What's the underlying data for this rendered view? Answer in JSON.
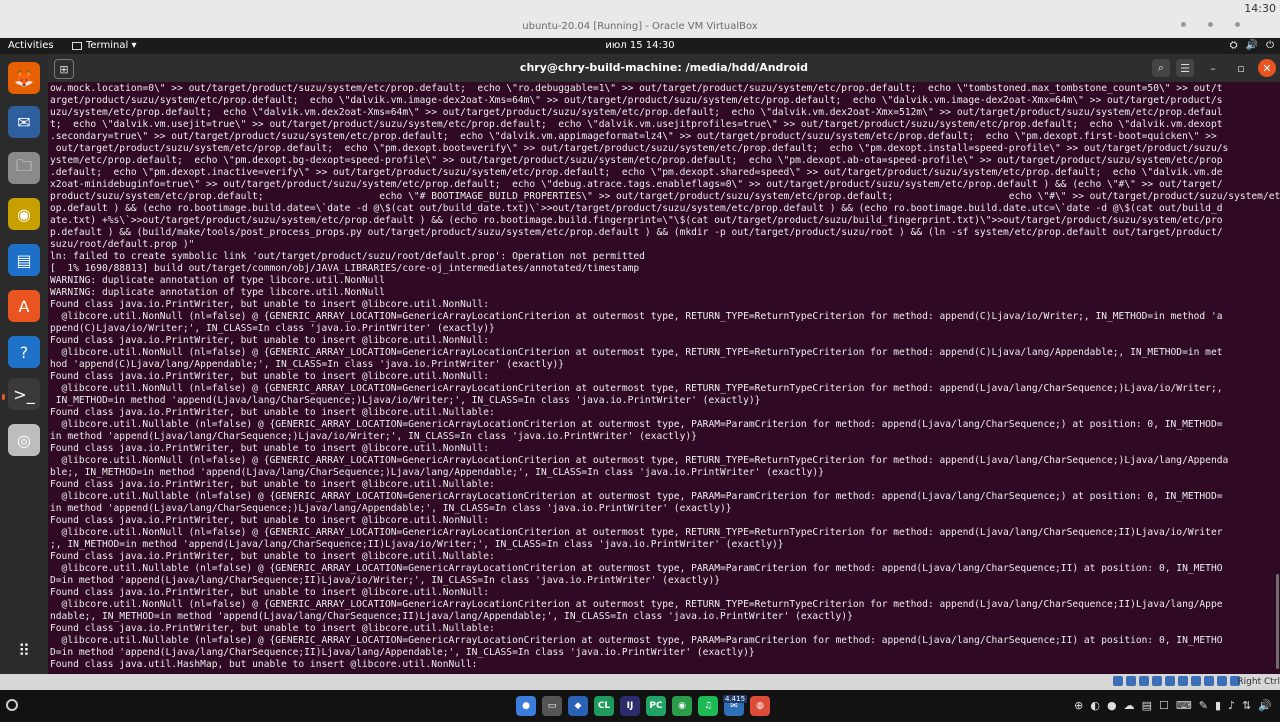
{
  "host": {
    "window_title": "ubuntu-20.04 [Running] - Oracle VM VirtualBox",
    "clock": "14:30",
    "host_key": "Right Ctrl"
  },
  "topbar": {
    "activities": "Activities",
    "app_name": "Terminal ▾",
    "datetime": "июл 15  14:30",
    "tray": [
      "⛭",
      "🔊",
      "⏻"
    ]
  },
  "dock": {
    "items": [
      {
        "name": "firefox-icon",
        "glyph": "🦊",
        "color": "#e66000"
      },
      {
        "name": "thunderbird-icon",
        "glyph": "✉",
        "color": "#2f5e9e"
      },
      {
        "name": "files-icon",
        "glyph": "🗀",
        "color": "#8a8a8a"
      },
      {
        "name": "rhythmbox-icon",
        "glyph": "◉",
        "color": "#c7a000"
      },
      {
        "name": "writer-icon",
        "glyph": "▤",
        "color": "#1e6fc8"
      },
      {
        "name": "software-icon",
        "glyph": "A",
        "color": "#e95420"
      },
      {
        "name": "help-icon",
        "glyph": "?",
        "color": "#1e73c8"
      },
      {
        "name": "terminal-icon",
        "glyph": ">_",
        "color": "#3a3a3a"
      },
      {
        "name": "dvd-icon",
        "glyph": "◎",
        "color": "#bdbdbd"
      },
      {
        "name": "show-apps-icon",
        "glyph": "⠿",
        "color": "transparent"
      }
    ]
  },
  "terminal": {
    "title": "chry@chry-build-machine: /media/hdd/Android",
    "lines": [
      "ow.mock.location=0\\\" >> out/target/product/suzu/system/etc/prop.default;  echo \\\"ro.debuggable=1\\\" >> out/target/product/suzu/system/etc/prop.default;  echo \\\"tombstoned.max_tombstone_count=50\\\" >> out/t",
      "arget/product/suzu/system/etc/prop.default;  echo \\\"dalvik.vm.image-dex2oat-Xms=64m\\\" >> out/target/product/suzu/system/etc/prop.default;  echo \\\"dalvik.vm.image-dex2oat-Xmx=64m\\\" >> out/target/product/s",
      "uzu/system/etc/prop.default;  echo \\\"dalvik.vm.dex2oat-Xms=64m\\\" >> out/target/product/suzu/system/etc/prop.default;  echo \\\"dalvik.vm.dex2oat-Xmx=512m\\\" >> out/target/product/suzu/system/etc/prop.defaul",
      "t;  echo \\\"dalvik.vm.usejit=true\\\" >> out/target/product/suzu/system/etc/prop.default;  echo \\\"dalvik.vm.usejitprofiles=true\\\" >> out/target/product/suzu/system/etc/prop.default;  echo \\\"dalvik.vm.dexopt",
      ".secondary=true\\\" >> out/target/product/suzu/system/etc/prop.default;  echo \\\"dalvik.vm.appimageformat=lz4\\\" >> out/target/product/suzu/system/etc/prop.default;  echo \\\"pm.dexopt.first-boot=quicken\\\" >>",
      " out/target/product/suzu/system/etc/prop.default;  echo \\\"pm.dexopt.boot=verify\\\" >> out/target/product/suzu/system/etc/prop.default;  echo \\\"pm.dexopt.install=speed-profile\\\" >> out/target/product/suzu/s",
      "ystem/etc/prop.default;  echo \\\"pm.dexopt.bg-dexopt=speed-profile\\\" >> out/target/product/suzu/system/etc/prop.default;  echo \\\"pm.dexopt.ab-ota=speed-profile\\\" >> out/target/product/suzu/system/etc/prop",
      ".default;  echo \\\"pm.dexopt.inactive=verify\\\" >> out/target/product/suzu/system/etc/prop.default;  echo \\\"pm.dexopt.shared=speed\\\" >> out/target/product/suzu/system/etc/prop.default;  echo \\\"dalvik.vm.de",
      "x2oat-minidebuginfo=true\\\" >> out/target/product/suzu/system/etc/prop.default;  echo \\\"debug.atrace.tags.enableflags=0\\\" >> out/target/product/suzu/system/etc/prop.default ) && (echo \\\"#\\\" >> out/target/",
      "product/suzu/system/etc/prop.default;                    echo \\\"# BOOTIMAGE_BUILD_PROPERTIES\\\" >> out/target/product/suzu/system/etc/prop.default;                    echo \\\"#\\\" >> out/target/product/suzu/system/etc/pr",
      "op.default ) && (echo ro.bootimage.build.date=\\`date -d @\\$(cat out/build_date.txt)\\`>>out/target/product/suzu/system/etc/prop.default ) && (echo ro.bootimage.build.date.utc=\\`date -d @\\$(cat out/build_d",
      "ate.txt) +%s\\`>>out/target/product/suzu/system/etc/prop.default ) && (echo ro.bootimage.build.fingerprint=\\\"\\$(cat out/target/product/suzu/build_fingerprint.txt)\\\">>out/target/product/suzu/system/etc/pro",
      "p.default ) && (build/make/tools/post_process_props.py out/target/product/suzu/system/etc/prop.default ) && (mkdir -p out/target/product/suzu/root ) && (ln -sf system/etc/prop.default out/target/product/",
      "suzu/root/default.prop )\"",
      "ln: failed to create symbolic link 'out/target/product/suzu/root/default.prop': Operation not permitted",
      "[  1% 1690/88813] build out/target/common/obj/JAVA_LIBRARIES/core-oj_intermediates/annotated/timestamp",
      "WARNING: duplicate annotation of type libcore.util.NonNull",
      "WARNING: duplicate annotation of type libcore.util.NonNull",
      "Found class java.io.PrintWriter, but unable to insert @libcore.util.NonNull:",
      "  @libcore.util.NonNull (nl=false) @ {GENERIC_ARRAY_LOCATION=GenericArrayLocationCriterion at outermost type, RETURN_TYPE=ReturnTypeCriterion for method: append(C)Ljava/io/Writer;, IN_METHOD=in method 'a",
      "ppend(C)Ljava/io/Writer;', IN_CLASS=In class 'java.io.PrintWriter' (exactly)}",
      "Found class java.io.PrintWriter, but unable to insert @libcore.util.NonNull:",
      "  @libcore.util.NonNull (nl=false) @ {GENERIC_ARRAY_LOCATION=GenericArrayLocationCriterion at outermost type, RETURN_TYPE=ReturnTypeCriterion for method: append(C)Ljava/lang/Appendable;, IN_METHOD=in met",
      "hod 'append(C)Ljava/lang/Appendable;', IN_CLASS=In class 'java.io.PrintWriter' (exactly)}",
      "Found class java.io.PrintWriter, but unable to insert @libcore.util.NonNull:",
      "  @libcore.util.NonNull (nl=false) @ {GENERIC_ARRAY_LOCATION=GenericArrayLocationCriterion at outermost type, RETURN_TYPE=ReturnTypeCriterion for method: append(Ljava/lang/CharSequence;)Ljava/io/Writer;,",
      " IN_METHOD=in method 'append(Ljava/lang/CharSequence;)Ljava/io/Writer;', IN_CLASS=In class 'java.io.PrintWriter' (exactly)}",
      "Found class java.io.PrintWriter, but unable to insert @libcore.util.Nullable:",
      "  @libcore.util.Nullable (nl=false) @ {GENERIC_ARRAY_LOCATION=GenericArrayLocationCriterion at outermost type, PARAM=ParamCriterion for method: append(Ljava/lang/CharSequence;) at position: 0, IN_METHOD=",
      "in method 'append(Ljava/lang/CharSequence;)Ljava/io/Writer;', IN_CLASS=In class 'java.io.PrintWriter' (exactly)}",
      "Found class java.io.PrintWriter, but unable to insert @libcore.util.NonNull:",
      "  @libcore.util.NonNull (nl=false) @ {GENERIC_ARRAY_LOCATION=GenericArrayLocationCriterion at outermost type, RETURN_TYPE=ReturnTypeCriterion for method: append(Ljava/lang/CharSequence;)Ljava/lang/Appenda",
      "ble;, IN_METHOD=in method 'append(Ljava/lang/CharSequence;)Ljava/lang/Appendable;', IN_CLASS=In class 'java.io.PrintWriter' (exactly)}",
      "Found class java.io.PrintWriter, but unable to insert @libcore.util.Nullable:",
      "  @libcore.util.Nullable (nl=false) @ {GENERIC_ARRAY_LOCATION=GenericArrayLocationCriterion at outermost type, PARAM=ParamCriterion for method: append(Ljava/lang/CharSequence;) at position: 0, IN_METHOD=",
      "in method 'append(Ljava/lang/CharSequence;)Ljava/lang/Appendable;', IN_CLASS=In class 'java.io.PrintWriter' (exactly)}",
      "Found class java.io.PrintWriter, but unable to insert @libcore.util.NonNull:",
      "  @libcore.util.NonNull (nl=false) @ {GENERIC_ARRAY_LOCATION=GenericArrayLocationCriterion at outermost type, RETURN_TYPE=ReturnTypeCriterion for method: append(Ljava/lang/CharSequence;II)Ljava/io/Writer",
      ";, IN_METHOD=in method 'append(Ljava/lang/CharSequence;II)Ljava/io/Writer;', IN_CLASS=In class 'java.io.PrintWriter' (exactly)}",
      "Found class java.io.PrintWriter, but unable to insert @libcore.util.Nullable:",
      "  @libcore.util.Nullable (nl=false) @ {GENERIC_ARRAY_LOCATION=GenericArrayLocationCriterion at outermost type, PARAM=ParamCriterion for method: append(Ljava/lang/CharSequence;II) at position: 0, IN_METHO",
      "D=in method 'append(Ljava/lang/CharSequence;II)Ljava/io/Writer;', IN_CLASS=In class 'java.io.PrintWriter' (exactly)}",
      "Found class java.io.PrintWriter, but unable to insert @libcore.util.NonNull:",
      "  @libcore.util.NonNull (nl=false) @ {GENERIC_ARRAY_LOCATION=GenericArrayLocationCriterion at outermost type, RETURN_TYPE=ReturnTypeCriterion for method: append(Ljava/lang/CharSequence;II)Ljava/lang/Appe",
      "ndable;, IN_METHOD=in method 'append(Ljava/lang/CharSequence;II)Ljava/lang/Appendable;', IN_CLASS=In class 'java.io.PrintWriter' (exactly)}",
      "Found class java.io.PrintWriter, but unable to insert @libcore.util.Nullable:",
      "  @libcore.util.Nullable (nl=false) @ {GENERIC_ARRAY_LOCATION=GenericArrayLocationCriterion at outermost type, PARAM=ParamCriterion for method: append(Ljava/lang/CharSequence;II) at position: 0, IN_METHO",
      "D=in method 'append(Ljava/lang/CharSequence;II)Ljava/lang/Appendable;', IN_CLASS=In class 'java.io.PrintWriter' (exactly)}",
      "Found class java.util.HashMap, but unable to insert @libcore.util.NonNull:"
    ]
  },
  "taskbar": {
    "apps": [
      {
        "name": "orb-icon",
        "label": "●",
        "color": "#3b7ddd"
      },
      {
        "name": "console-icon",
        "label": "▭",
        "color": "#555"
      },
      {
        "name": "virtualbox-icon",
        "label": "◆",
        "color": "#2a62b8"
      },
      {
        "name": "clion-icon",
        "label": "CL",
        "color": "#1d9a5c"
      },
      {
        "name": "intellij-icon",
        "label": "IJ",
        "color": "#2c2c6c"
      },
      {
        "name": "pycharm-icon",
        "label": "PC",
        "color": "#21a366"
      },
      {
        "name": "maps-icon",
        "label": "◉",
        "color": "#2a9d4a"
      },
      {
        "name": "spotify-icon",
        "label": "♫",
        "color": "#1db954"
      },
      {
        "name": "mail-icon",
        "label": "✉",
        "color": "#2f6fb8"
      },
      {
        "name": "chrome-icon",
        "label": "◍",
        "color": "#dd4b39"
      }
    ],
    "badge": "4.415",
    "tray": [
      "⊕",
      "◐",
      "●",
      "☁",
      "▤",
      "☐",
      "⌨",
      "✎",
      "▮",
      "♪",
      "⇅",
      "🔊"
    ]
  }
}
